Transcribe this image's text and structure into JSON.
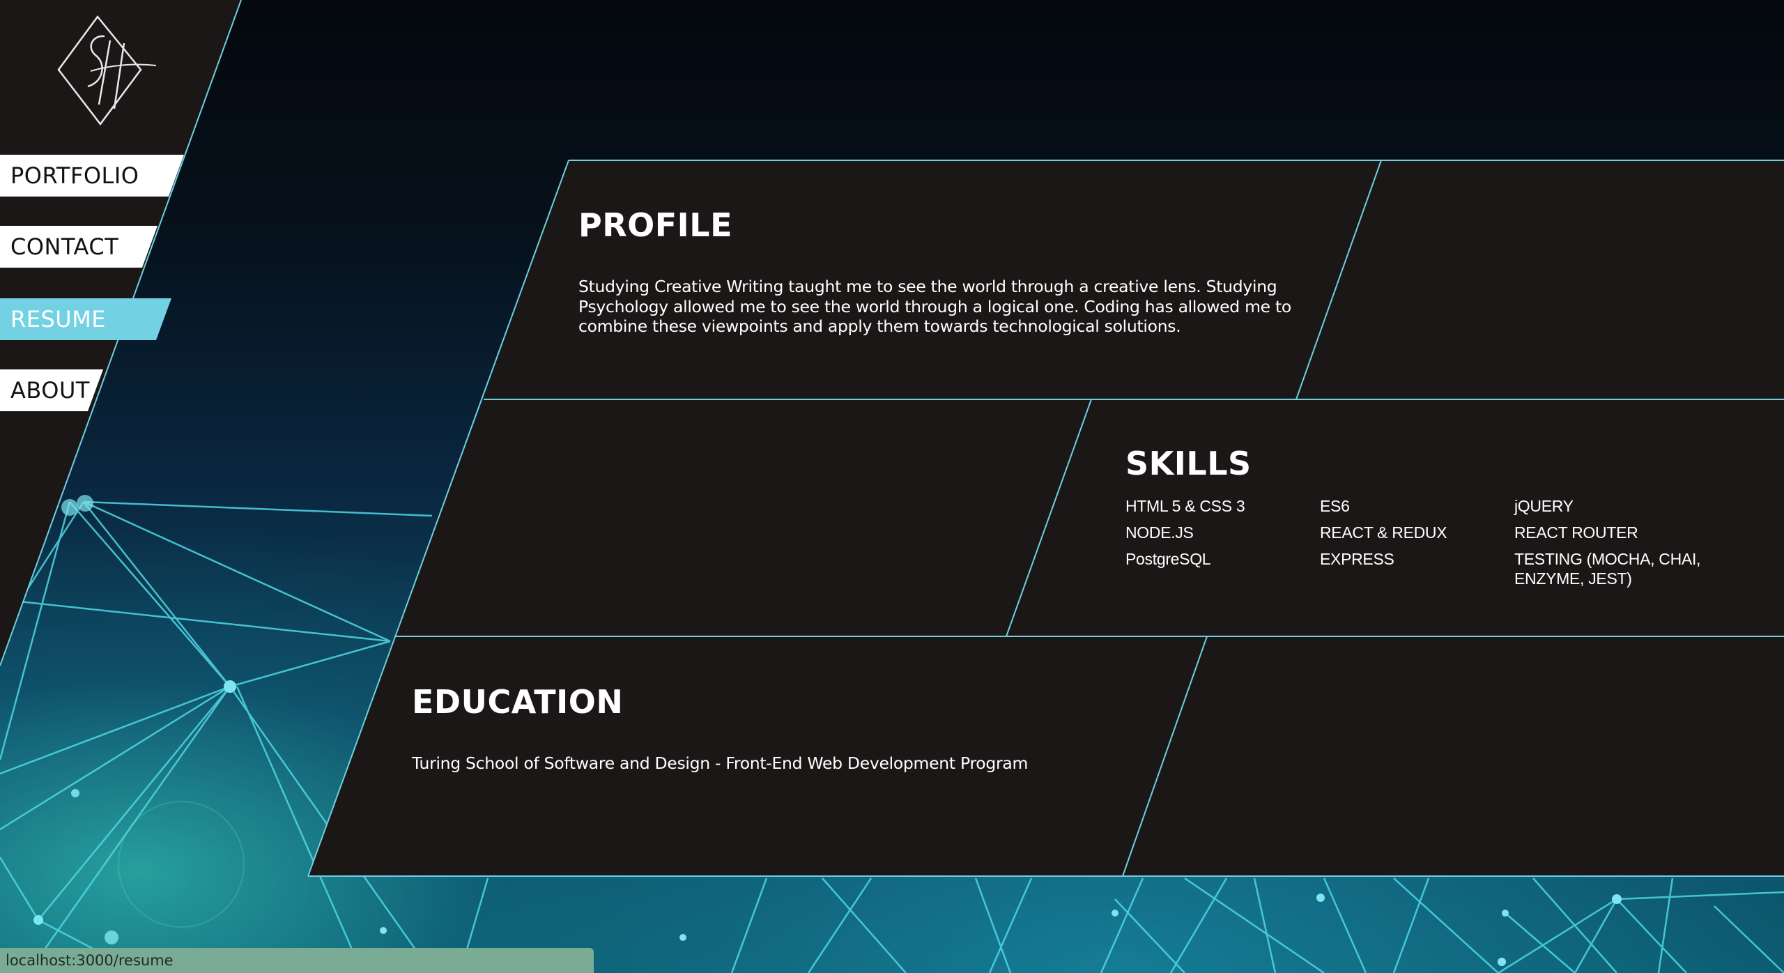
{
  "logo": {
    "icon": "sh-monogram-logo",
    "alt": "SH"
  },
  "nav": {
    "items": [
      {
        "label": "PORTFOLIO",
        "active": false
      },
      {
        "label": "CONTACT",
        "active": false
      },
      {
        "label": "RESUME",
        "active": true
      },
      {
        "label": "ABOUT",
        "active": false
      }
    ]
  },
  "profile": {
    "heading": "PROFILE",
    "lines": [
      "Studying Creative Writing taught me to see the world through a creative lens. Studying",
      "Psychology allowed me to see the world through a logical one. Coding has allowed me to",
      "combine these viewpoints and apply them towards technological solutions."
    ]
  },
  "skills": {
    "heading": "SKILLS",
    "col1": [
      "HTML 5 & CSS 3",
      "NODE.JS",
      "PostgreSQL"
    ],
    "col2": [
      "ES6",
      "REACT & REDUX",
      "EXPRESS"
    ],
    "col3": [
      "jQUERY",
      "REACT ROUTER",
      "TESTING (MOCHA, CHAI,",
      "ENZYME, JEST)"
    ]
  },
  "education": {
    "heading": "EDUCATION",
    "item": "Turing School of Software and Design - Front-End Web Development Program"
  },
  "status_bar": {
    "url": "localhost:3000/resume"
  },
  "colors": {
    "panel": "#1c1717",
    "accent": "#72d2e4",
    "outline": "#6fcfe0"
  }
}
